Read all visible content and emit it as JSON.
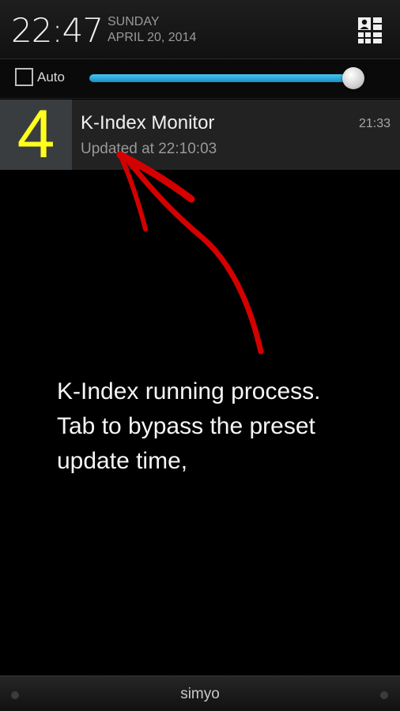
{
  "status_header": {
    "time": "22:47",
    "day_of_week": "SUNDAY",
    "date": "APRIL 20, 2014",
    "settings_icon": "quick-settings-icon"
  },
  "brightness": {
    "auto_label": "Auto",
    "auto_checked": false,
    "level_fraction": 0.97,
    "accent_color": "#33b5e5"
  },
  "notification": {
    "icon_number": "4",
    "icon_color": "#ffff1e",
    "title": "K-Index Monitor",
    "subtitle": "Updated at 22:10:03",
    "time": "21:33"
  },
  "annotation": {
    "text": "K-Index running process.\nTab to bypass the preset\nupdate time,",
    "arrow_color": "#d40000"
  },
  "carrier": {
    "label": "simyo"
  }
}
